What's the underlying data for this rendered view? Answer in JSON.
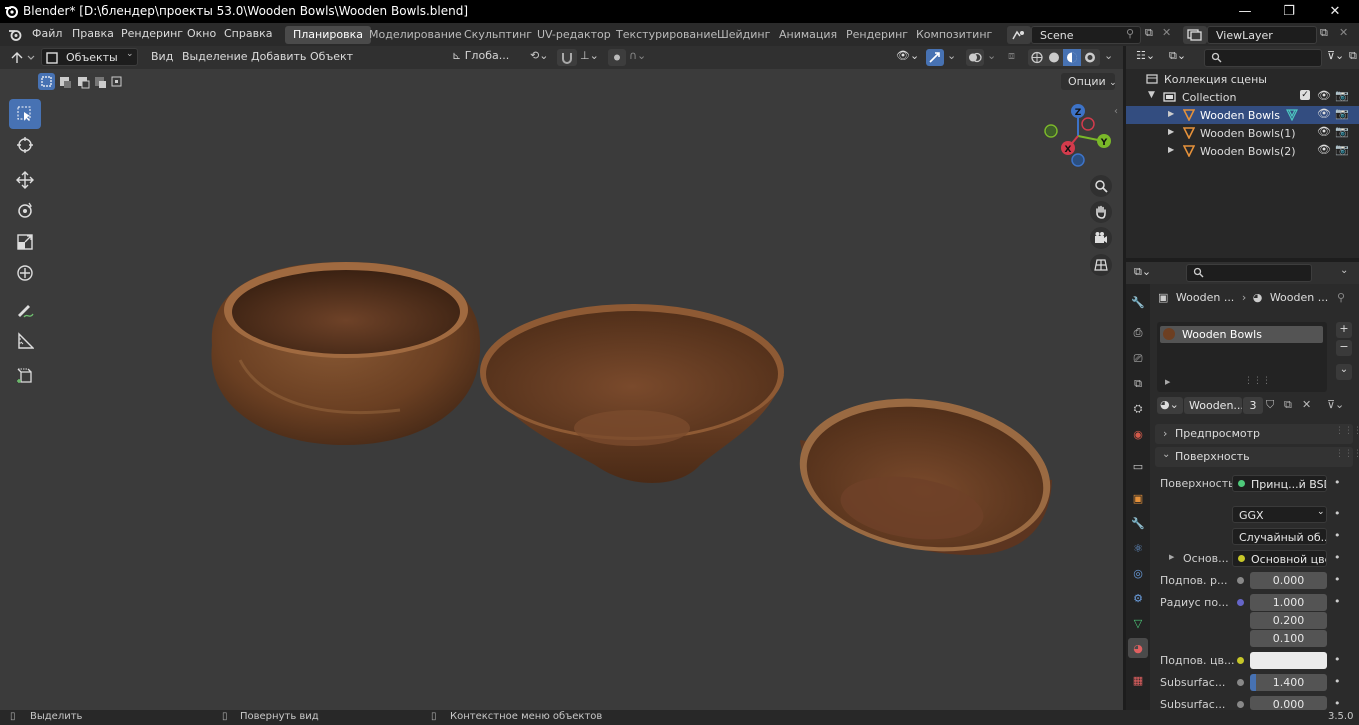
{
  "window": {
    "title": "Blender* [D:\\блендер\\проекты 53.0\\Wooden Bowls\\Wooden Bowls.blend]",
    "minimize": "—",
    "maximize": "❐",
    "close": "✕"
  },
  "menu": {
    "items": [
      "Файл",
      "Правка",
      "Рендеринг",
      "Окно",
      "Справка"
    ]
  },
  "workspaces": {
    "tabs": [
      "Планировка",
      "Моделирование",
      "Скульптинг",
      "UV-редактор",
      "Текстурирование",
      "Шейдинг",
      "Анимация",
      "Рендеринг",
      "Композитинг"
    ],
    "active": "Планировка"
  },
  "scene": {
    "name": "Scene",
    "view_layer": "ViewLayer"
  },
  "viewport": {
    "mode": "Объекты",
    "header_menus": [
      "Вид",
      "Выделение",
      "Добавить",
      "Объект"
    ],
    "orientation": "Глоба...",
    "options_label": "Опции",
    "gizmo": {
      "z": "Z",
      "y": "Y",
      "x": "X"
    }
  },
  "outliner": {
    "scene_collection": "Коллекция сцены",
    "collection": "Collection",
    "objects": [
      {
        "name": "Wooden Bowls",
        "selected": true
      },
      {
        "name": "Wooden Bowls(1)",
        "selected": false
      },
      {
        "name": "Wooden Bowls(2)",
        "selected": false
      }
    ]
  },
  "properties": {
    "breadcrumb": [
      "Wooden ...",
      "Wooden ..."
    ],
    "material_slot": "Wooden Bowls",
    "material_name": "Wooden...",
    "user_count": "3",
    "panels": {
      "preview": "Предпросмотр",
      "surface": "Поверхность"
    },
    "surface_label": "Поверхность",
    "surface_value": "Принц...й BSDF",
    "distribution": "GGX",
    "subsurface_method": "Случайный об...",
    "rows": [
      {
        "label": "Основ...",
        "value": "Основной цвет"
      },
      {
        "label": "Подпов. р...",
        "value": "0.000"
      },
      {
        "label": "Радиус по...",
        "value": "1.000"
      },
      {
        "label": "",
        "value": "0.200"
      },
      {
        "label": "",
        "value": "0.100"
      },
      {
        "label": "Подпов. цв...",
        "value": ""
      },
      {
        "label": "Subsurfac...",
        "value": "1.400"
      },
      {
        "label": "Subsurfac...",
        "value": "0.000"
      }
    ]
  },
  "statusbar": {
    "select": "Выделить",
    "rotate": "Повернуть вид",
    "context": "Контекстное меню объектов",
    "version": "3.5.0"
  },
  "colors": {
    "accent": "#4772b3",
    "selection": "#334d80",
    "viewport_bg": "#3b3b3b"
  }
}
